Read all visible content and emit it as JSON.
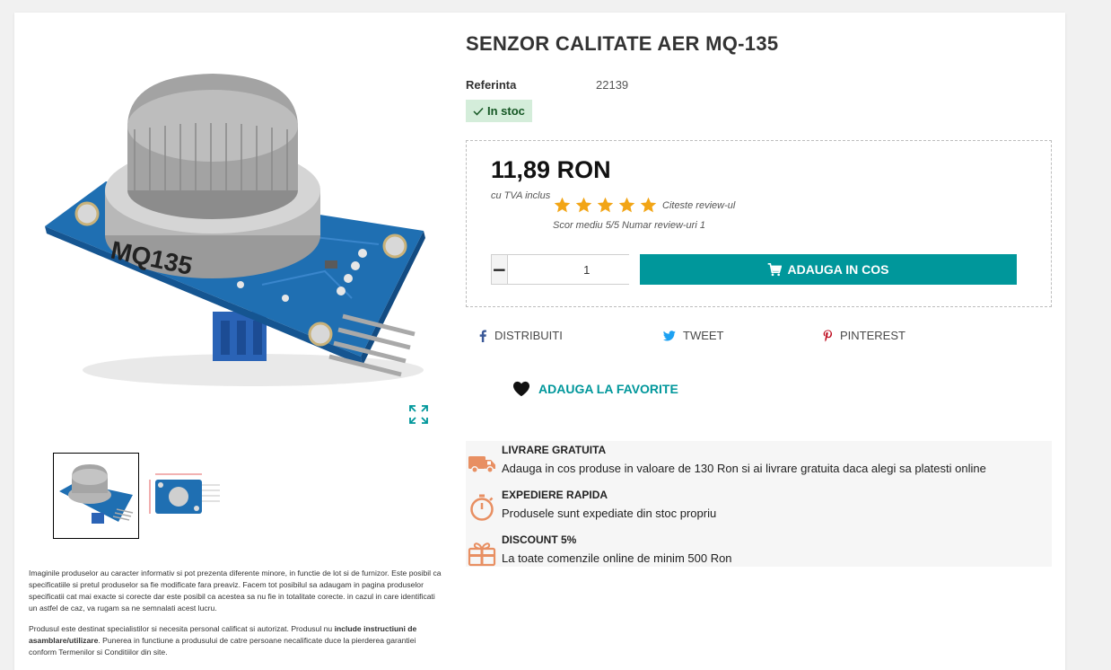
{
  "product": {
    "title": "SENZOR CALITATE AER MQ-135",
    "reference_label": "Referinta",
    "reference_value": "22139",
    "stock": "In stoc",
    "price": "11,89 RON",
    "tax_note": "cu TVA inclus",
    "rating": 5,
    "review_link": "Citeste review-ul",
    "review_score": "Scor mediu 5/5 Numar review-uri 1",
    "quantity": "1",
    "add_to_cart": "ADAUGA IN COS",
    "image_text": "MQ135"
  },
  "share": {
    "facebook": "Distribuiti",
    "twitter": "Tweet",
    "pinterest": "Pinterest"
  },
  "favorite": "ADAUGA LA FAVORITE",
  "reassurance": [
    {
      "icon": "delivery-truck-icon",
      "title": "LIVRARE GRATUITA",
      "text": "Adauga in cos produse in valoare de 130 Ron si ai livrare gratuita daca alegi sa platesti online"
    },
    {
      "icon": "stopwatch-icon",
      "title": "EXPEDIERE RAPIDA",
      "text": "Produsele sunt expediate din stoc propriu"
    },
    {
      "icon": "gift-icon",
      "title": "DISCOUNT 5%",
      "text": "La toate comenzile online de minim 500 Ron"
    }
  ],
  "disclaimer": {
    "p1": "Imaginile produselor au caracter informativ si pot prezenta diferente minore, in functie de lot si de furnizor. Este posibil ca specificatiile si pretul produselor sa fie modificate fara preaviz. Facem tot posibilul sa adaugam in pagina produselor specificatii cat mai exacte si corecte dar este posibil ca acestea sa nu fie in totalitate corecte. in cazul in care identificati un astfel de caz, va rugam sa ne semnalati acest lucru.",
    "p2_start": "Produsul este destinat specialistilor si necesita personal calificat si autorizat. Produsul nu ",
    "p2_bold": "include instructiuni de asamblare/utilizare",
    "p2_end": ". Punerea in functiune a produsului de catre persoane necalificate duce la pierderea garantiei conform Termenilor si Conditiilor din site."
  },
  "colors": {
    "accent": "#00979b",
    "stock_bg": "#d4edda",
    "stock_text": "#155724",
    "star": "#f2a516",
    "reassurance_icon": "#e88f62"
  }
}
